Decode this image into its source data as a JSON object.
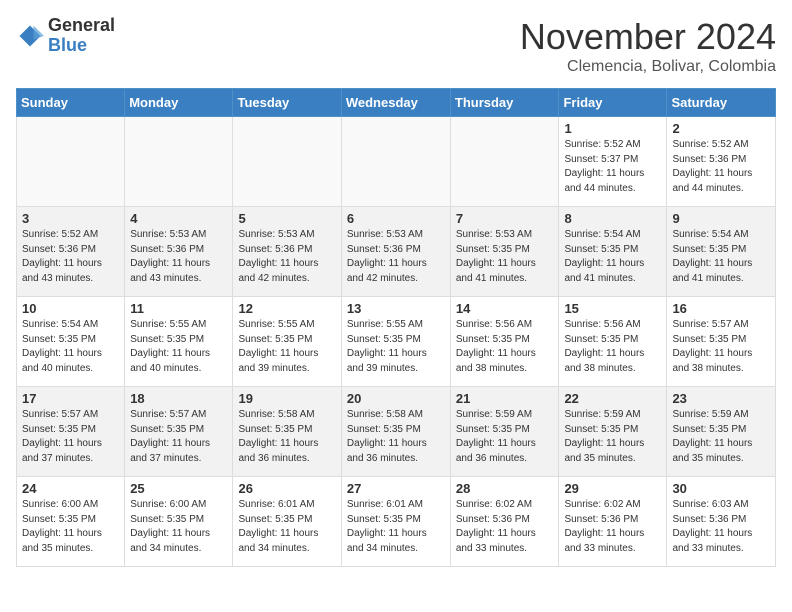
{
  "header": {
    "logo_general": "General",
    "logo_blue": "Blue",
    "month_title": "November 2024",
    "location": "Clemencia, Bolivar, Colombia"
  },
  "calendar": {
    "days_of_week": [
      "Sunday",
      "Monday",
      "Tuesday",
      "Wednesday",
      "Thursday",
      "Friday",
      "Saturday"
    ],
    "weeks": [
      [
        {
          "num": "",
          "info": ""
        },
        {
          "num": "",
          "info": ""
        },
        {
          "num": "",
          "info": ""
        },
        {
          "num": "",
          "info": ""
        },
        {
          "num": "",
          "info": ""
        },
        {
          "num": "1",
          "info": "Sunrise: 5:52 AM\nSunset: 5:37 PM\nDaylight: 11 hours\nand 44 minutes."
        },
        {
          "num": "2",
          "info": "Sunrise: 5:52 AM\nSunset: 5:36 PM\nDaylight: 11 hours\nand 44 minutes."
        }
      ],
      [
        {
          "num": "3",
          "info": "Sunrise: 5:52 AM\nSunset: 5:36 PM\nDaylight: 11 hours\nand 43 minutes."
        },
        {
          "num": "4",
          "info": "Sunrise: 5:53 AM\nSunset: 5:36 PM\nDaylight: 11 hours\nand 43 minutes."
        },
        {
          "num": "5",
          "info": "Sunrise: 5:53 AM\nSunset: 5:36 PM\nDaylight: 11 hours\nand 42 minutes."
        },
        {
          "num": "6",
          "info": "Sunrise: 5:53 AM\nSunset: 5:36 PM\nDaylight: 11 hours\nand 42 minutes."
        },
        {
          "num": "7",
          "info": "Sunrise: 5:53 AM\nSunset: 5:35 PM\nDaylight: 11 hours\nand 41 minutes."
        },
        {
          "num": "8",
          "info": "Sunrise: 5:54 AM\nSunset: 5:35 PM\nDaylight: 11 hours\nand 41 minutes."
        },
        {
          "num": "9",
          "info": "Sunrise: 5:54 AM\nSunset: 5:35 PM\nDaylight: 11 hours\nand 41 minutes."
        }
      ],
      [
        {
          "num": "10",
          "info": "Sunrise: 5:54 AM\nSunset: 5:35 PM\nDaylight: 11 hours\nand 40 minutes."
        },
        {
          "num": "11",
          "info": "Sunrise: 5:55 AM\nSunset: 5:35 PM\nDaylight: 11 hours\nand 40 minutes."
        },
        {
          "num": "12",
          "info": "Sunrise: 5:55 AM\nSunset: 5:35 PM\nDaylight: 11 hours\nand 39 minutes."
        },
        {
          "num": "13",
          "info": "Sunrise: 5:55 AM\nSunset: 5:35 PM\nDaylight: 11 hours\nand 39 minutes."
        },
        {
          "num": "14",
          "info": "Sunrise: 5:56 AM\nSunset: 5:35 PM\nDaylight: 11 hours\nand 38 minutes."
        },
        {
          "num": "15",
          "info": "Sunrise: 5:56 AM\nSunset: 5:35 PM\nDaylight: 11 hours\nand 38 minutes."
        },
        {
          "num": "16",
          "info": "Sunrise: 5:57 AM\nSunset: 5:35 PM\nDaylight: 11 hours\nand 38 minutes."
        }
      ],
      [
        {
          "num": "17",
          "info": "Sunrise: 5:57 AM\nSunset: 5:35 PM\nDaylight: 11 hours\nand 37 minutes."
        },
        {
          "num": "18",
          "info": "Sunrise: 5:57 AM\nSunset: 5:35 PM\nDaylight: 11 hours\nand 37 minutes."
        },
        {
          "num": "19",
          "info": "Sunrise: 5:58 AM\nSunset: 5:35 PM\nDaylight: 11 hours\nand 36 minutes."
        },
        {
          "num": "20",
          "info": "Sunrise: 5:58 AM\nSunset: 5:35 PM\nDaylight: 11 hours\nand 36 minutes."
        },
        {
          "num": "21",
          "info": "Sunrise: 5:59 AM\nSunset: 5:35 PM\nDaylight: 11 hours\nand 36 minutes."
        },
        {
          "num": "22",
          "info": "Sunrise: 5:59 AM\nSunset: 5:35 PM\nDaylight: 11 hours\nand 35 minutes."
        },
        {
          "num": "23",
          "info": "Sunrise: 5:59 AM\nSunset: 5:35 PM\nDaylight: 11 hours\nand 35 minutes."
        }
      ],
      [
        {
          "num": "24",
          "info": "Sunrise: 6:00 AM\nSunset: 5:35 PM\nDaylight: 11 hours\nand 35 minutes."
        },
        {
          "num": "25",
          "info": "Sunrise: 6:00 AM\nSunset: 5:35 PM\nDaylight: 11 hours\nand 34 minutes."
        },
        {
          "num": "26",
          "info": "Sunrise: 6:01 AM\nSunset: 5:35 PM\nDaylight: 11 hours\nand 34 minutes."
        },
        {
          "num": "27",
          "info": "Sunrise: 6:01 AM\nSunset: 5:35 PM\nDaylight: 11 hours\nand 34 minutes."
        },
        {
          "num": "28",
          "info": "Sunrise: 6:02 AM\nSunset: 5:36 PM\nDaylight: 11 hours\nand 33 minutes."
        },
        {
          "num": "29",
          "info": "Sunrise: 6:02 AM\nSunset: 5:36 PM\nDaylight: 11 hours\nand 33 minutes."
        },
        {
          "num": "30",
          "info": "Sunrise: 6:03 AM\nSunset: 5:36 PM\nDaylight: 11 hours\nand 33 minutes."
        }
      ]
    ]
  }
}
